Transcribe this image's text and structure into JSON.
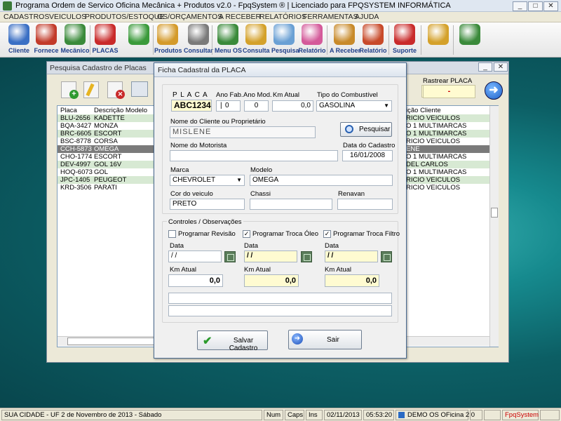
{
  "window": {
    "title": "Programa Ordem de Servico Oficina Mecânica + Produtos v2.0 - FpqSystem ®  | Licenciado para  FPQSYSTEM INFORMÁTICA"
  },
  "menu": [
    "CADASTROS",
    "VEICULOS",
    "PRODUTOS/ESTOQUE",
    "OS/ORÇAMENTOS",
    "A RECEBER",
    "RELATÓRIOS",
    "FERRAMENTAS",
    "AJUDA"
  ],
  "toolbar": [
    {
      "label": "Cliente",
      "icon": "person-icon",
      "color": "#3a6fc4"
    },
    {
      "label": "Fornece",
      "icon": "person-icon",
      "color": "#c23a2a"
    },
    {
      "label": "Mecânico",
      "icon": "person-icon",
      "color": "#3a8a3a"
    },
    {
      "label": "PLACAS",
      "icon": "car-icon",
      "color": "#c92a2a"
    },
    {
      "label": "",
      "icon": "clock-icon",
      "color": "#3a9a3a"
    },
    {
      "label": "Produtos",
      "icon": "boxes-icon",
      "color": "#d49a2a"
    },
    {
      "label": "Consultar",
      "icon": "cylinder-icon",
      "color": "#7a7a7a"
    },
    {
      "label": "Menu OS",
      "icon": "clipboard-icon",
      "color": "#3a8a3a"
    },
    {
      "label": "Consulta",
      "icon": "folder-icon",
      "color": "#d4a12a"
    },
    {
      "label": "Pesquisa",
      "icon": "magnifier-icon",
      "color": "#6aa0d4"
    },
    {
      "label": "Relatório",
      "icon": "report-icon",
      "color": "#d45a9a"
    },
    {
      "label": "A Receber",
      "icon": "tools-icon",
      "color": "#c88a2a"
    },
    {
      "label": "Relatório",
      "icon": "chart-icon",
      "color": "#c84a2a"
    },
    {
      "label": "Suporte",
      "icon": "support-icon",
      "color": "#c92a2a"
    },
    {
      "label": "",
      "icon": "coin-icon",
      "color": "#d4a12a"
    },
    {
      "label": "",
      "icon": "exit-icon",
      "color": "#3a8a3a"
    }
  ],
  "backwin": {
    "title": "Pesquisa Cadastro de Placas",
    "track_label": "Rastrear PLACA",
    "track_value": "-",
    "col_placa": "Placa",
    "col_modelo": "Descrição Modelo",
    "col_cliente": "ição Cliente",
    "rows": [
      {
        "placa": "BLU-2656",
        "modelo": "KADETTE",
        "cliente": "RICIO VEICULOS"
      },
      {
        "placa": "BQA-3427",
        "modelo": "MONZA",
        "cliente": "O 1 MULTIMARCAS"
      },
      {
        "placa": "BRC-6605",
        "modelo": "ESCORT",
        "cliente": "O 1 MULTIMARCAS"
      },
      {
        "placa": "BSC-8778",
        "modelo": "CORSA",
        "cliente": "RICIO VEICULOS"
      },
      {
        "placa": "CCH-5873",
        "modelo": "OMEGA",
        "cliente": "ENE"
      },
      {
        "placa": "CHO-1774",
        "modelo": "ESCORT",
        "cliente": "O 1 MULTIMARCAS"
      },
      {
        "placa": "DEV-4997",
        "modelo": "GOL 16V",
        "cliente": "DEL CARLOS"
      },
      {
        "placa": "HOQ-6073",
        "modelo": "GOL",
        "cliente": "O 1 MULTIMARCAS"
      },
      {
        "placa": "JPC-1405",
        "modelo": "PEUGEOT",
        "cliente": "RICIO VEICULOS"
      },
      {
        "placa": "KRD-3506",
        "modelo": "PARATI",
        "cliente": "RICIO VEICULOS"
      }
    ]
  },
  "dialog": {
    "title": "Ficha Cadastral da PLACA",
    "placa_label": "P L A C A",
    "placa_value": "ABC1234",
    "anofab_label": "Ano Fab.",
    "anofab_value": "0",
    "anomod_label": "Ano Mod.",
    "anomod_value": "0",
    "km_label": "Km Atual",
    "km_value": "0,0",
    "combustivel_label": "Tipo do Combustível",
    "combustivel_value": "GASOLINA",
    "cliente_label": "Nome do Cliente ou Proprietário",
    "cliente_value": "MISLENE",
    "pesquisar_label": "Pesquisar",
    "motorista_label": "Nome do Motorista",
    "motorista_value": "",
    "datacad_label": "Data do Cadastro",
    "datacad_value": "16/01/2008",
    "marca_label": "Marca",
    "marca_value": "CHEVROLET",
    "modelo_label": "Modelo",
    "modelo_value": "OMEGA",
    "cor_label": "Cor do veiculo",
    "cor_value": "PRETO",
    "chassi_label": "Chassi",
    "chassi_value": "",
    "renavan_label": "Renavan",
    "renavan_value": "",
    "controles_label": "Controles / Observações",
    "revisao": {
      "label": "Programar Revisão",
      "checked": false,
      "data": " / /",
      "km": "0,0"
    },
    "oleo": {
      "label": "Programar Troca Óleo",
      "checked": true,
      "data": " / /",
      "km": "0,0"
    },
    "filtro": {
      "label": "Programar Troca Filtro",
      "checked": true,
      "data": " / /",
      "km": "0,0"
    },
    "data_label": "Data",
    "kmatual_label": "Km Atual",
    "obs1": "",
    "obs2": "",
    "salvar_label": "Salvar Cadastro",
    "sair_label": "Sair"
  },
  "status": {
    "city": "SUA CIDADE - UF  2 de Novembro de 2013 - Sábado",
    "num": "Num",
    "caps": "Caps",
    "ins": "Ins",
    "date": "02/11/2013",
    "time": "05:53:20",
    "app": "DEMO OS OFicina 2.0",
    "brand": "FpqSystem"
  }
}
